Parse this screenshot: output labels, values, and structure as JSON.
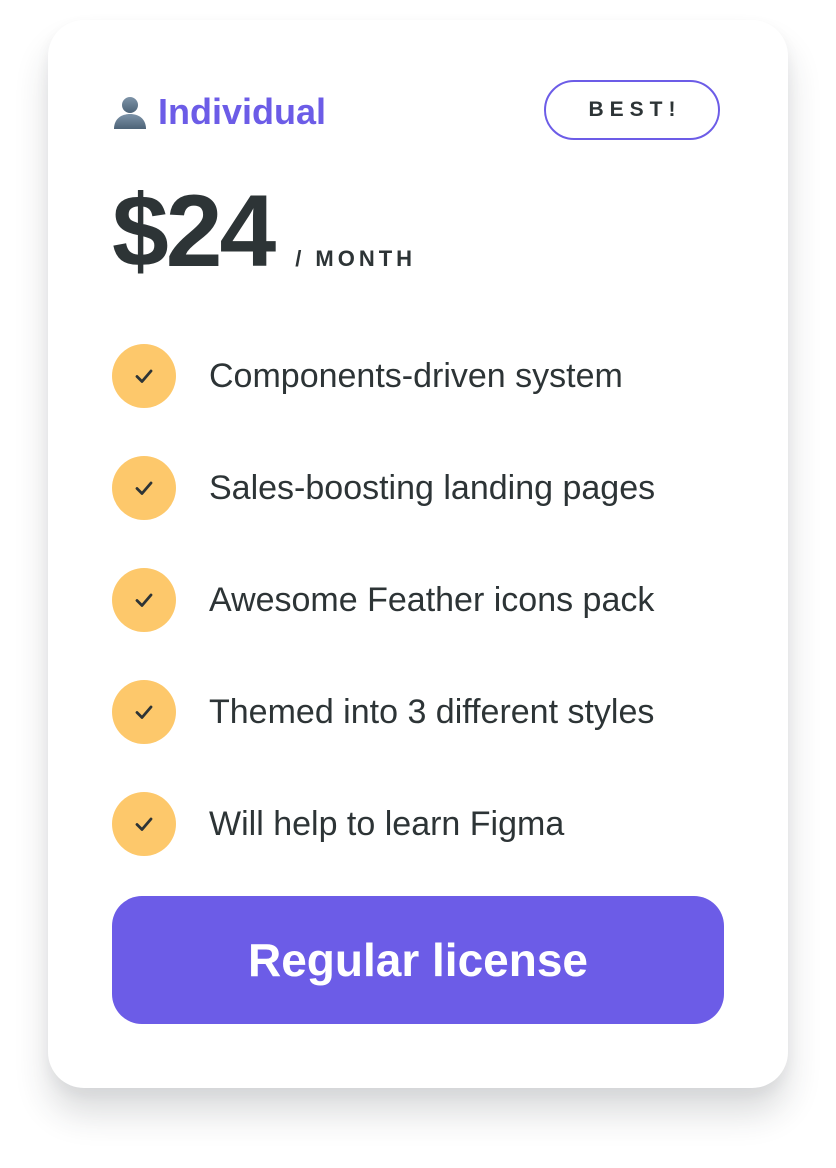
{
  "plan": {
    "icon": "user-icon",
    "name": "Individual"
  },
  "badge": {
    "label": "BEST!"
  },
  "price": {
    "amount": "$24",
    "period": "/ MONTH"
  },
  "features": [
    {
      "icon": "check-icon",
      "text": "Components-driven system"
    },
    {
      "icon": "check-icon",
      "text": "Sales-boosting landing pages"
    },
    {
      "icon": "check-icon",
      "text": "Awesome Feather icons pack"
    },
    {
      "icon": "check-icon",
      "text": "Themed into 3 different styles"
    },
    {
      "icon": "check-icon",
      "text": "Will help to learn Figma"
    }
  ],
  "cta": {
    "label": "Regular license"
  },
  "colors": {
    "accent": "#6c5ce7",
    "check_background": "#fdc86b",
    "text": "#2d3436",
    "card": "#ffffff"
  }
}
